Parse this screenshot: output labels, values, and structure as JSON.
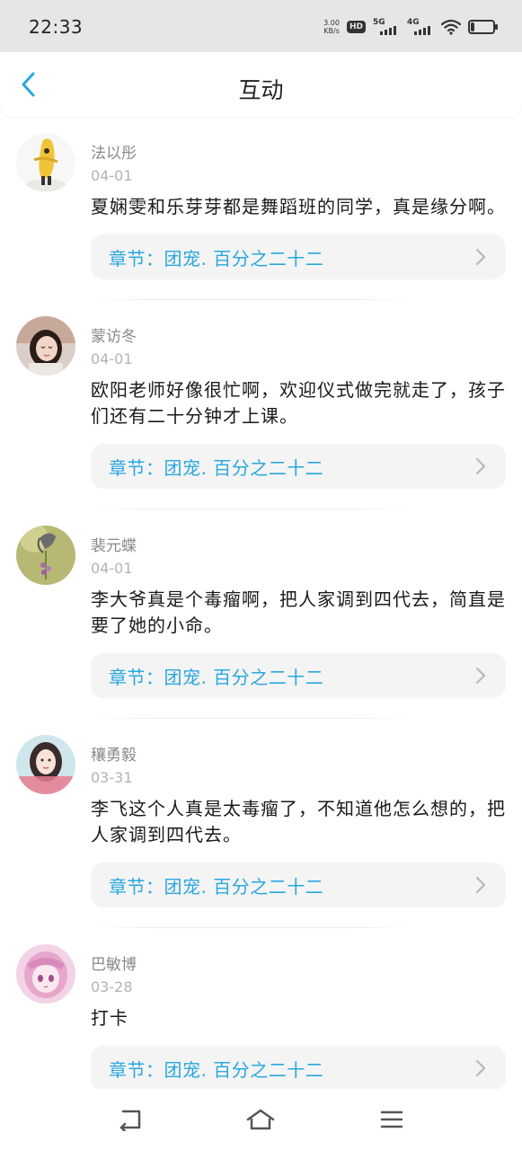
{
  "status": {
    "time": "22:33",
    "net_speed": "3.00",
    "net_unit": "KB/s",
    "hd": "HD",
    "sim1": "5G",
    "sim2": "4G",
    "battery": "18"
  },
  "header": {
    "title": "互动"
  },
  "comments": [
    {
      "author": "法以彤",
      "date": "04-01",
      "text": "夏娴雯和乐芽芽都是舞蹈班的同学，真是缘分啊。",
      "chapter": "章节：团宠. 百分之二十二"
    },
    {
      "author": "蒙访冬",
      "date": "04-01",
      "text": "欧阳老师好像很忙啊，欢迎仪式做完就走了，孩子们还有二十分钟才上课。",
      "chapter": "章节：团宠. 百分之二十二"
    },
    {
      "author": "裴元蝶",
      "date": "04-01",
      "text": "李大爷真是个毒瘤啊，把人家调到四代去，简直是要了她的小命。",
      "chapter": "章节：团宠. 百分之二十二"
    },
    {
      "author": "穰勇毅",
      "date": "03-31",
      "text": "李飞这个人真是太毒瘤了，不知道他怎么想的，把人家调到四代去。",
      "chapter": "章节：团宠. 百分之二十二"
    },
    {
      "author": "巴敏博",
      "date": "03-28",
      "text": "打卡",
      "chapter": "章节：团宠. 百分之二十二"
    }
  ],
  "colors": {
    "accent": "#2aa7de",
    "chapter_bg": "#f4f4f4",
    "status_bar_bg": "#e6e6e6"
  },
  "icons": {
    "back": "chevron-left-icon",
    "chapter": "chevron-right-icon",
    "nav_back": "back-arrow-icon",
    "nav_home": "home-icon",
    "nav_menu": "menu-icon"
  }
}
